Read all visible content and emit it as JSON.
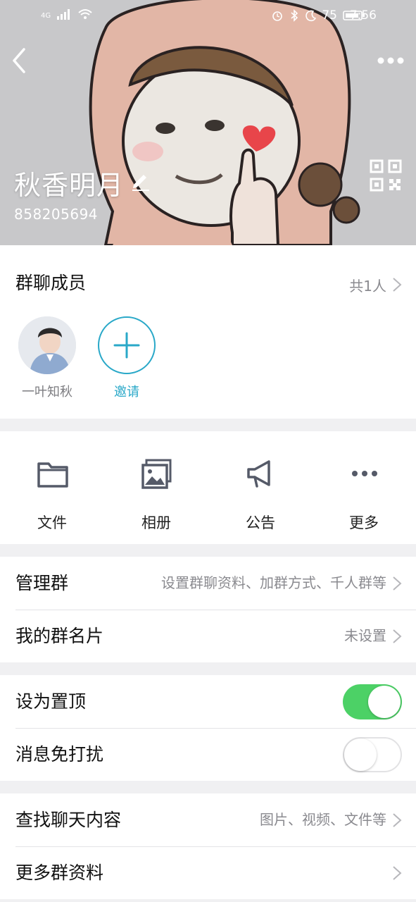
{
  "status_bar": {
    "network": "4G",
    "battery": "75",
    "time": "7:56"
  },
  "header": {
    "group_name": "秋香明月",
    "group_id": "858205694",
    "icons": [
      "back-arrow-icon",
      "more-dots-icon",
      "edit-pencil-icon",
      "qr-code-icon"
    ]
  },
  "members": {
    "title": "群聊成员",
    "count": "共1人",
    "list": [
      {
        "name": "一叶知秋"
      }
    ],
    "invite_label": "邀请"
  },
  "actions": [
    {
      "label": "文件",
      "icon": "folder-icon"
    },
    {
      "label": "相册",
      "icon": "album-icon"
    },
    {
      "label": "公告",
      "icon": "megaphone-icon"
    },
    {
      "label": "更多",
      "icon": "more-icon"
    }
  ],
  "settings": {
    "manage": {
      "label": "管理群",
      "value": "设置群聊资料、加群方式、千人群等"
    },
    "card": {
      "label": "我的群名片",
      "value": "未设置"
    },
    "pin": {
      "label": "设为置顶",
      "enabled": true
    },
    "mute": {
      "label": "消息免打扰",
      "enabled": false
    },
    "search": {
      "label": "查找聊天内容",
      "value": "图片、视频、文件等"
    },
    "more_info": {
      "label": "更多群资料"
    }
  },
  "colors": {
    "accent": "#29a8c8",
    "toggle_on": "#4cd166",
    "secondary_text": "#8a8a8f"
  }
}
